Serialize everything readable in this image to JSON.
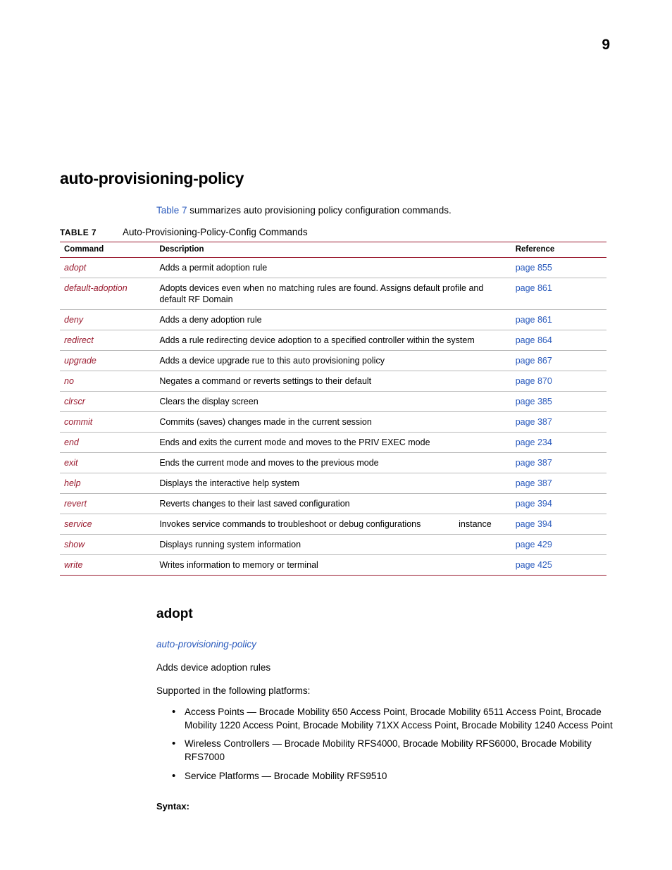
{
  "page": {
    "number": "9"
  },
  "section": {
    "title": "auto-provisioning-policy",
    "intro_link": "Table 7",
    "intro_text": " summarizes auto provisioning policy configuration commands."
  },
  "table": {
    "label": "TABLE 7",
    "caption": "Auto-Provisioning-Policy-Config Commands",
    "headers": [
      "Command",
      "Description",
      "Reference"
    ],
    "rows": [
      {
        "command": "adopt",
        "description": "Adds a permit adoption rule",
        "extra": "",
        "reference": "page 855"
      },
      {
        "command": "default-adoption",
        "description": "Adopts devices even when no matching rules are found. Assigns default profile and default RF Domain",
        "extra": "",
        "reference": "page 861"
      },
      {
        "command": "deny",
        "description": "Adds a deny adoption rule",
        "extra": "",
        "reference": "page 861"
      },
      {
        "command": "redirect",
        "description": "Adds a rule redirecting device adoption to a specified controller within the system",
        "extra": "",
        "reference": "page 864"
      },
      {
        "command": "upgrade",
        "description": "Adds a device upgrade rue to this auto provisioning policy",
        "extra": "",
        "reference": "page 867"
      },
      {
        "command": "no",
        "description": "Negates a command or reverts settings to their default",
        "extra": "",
        "reference": "page 870"
      },
      {
        "command": "clrscr",
        "description": "Clears the display screen",
        "extra": "",
        "reference": "page 385"
      },
      {
        "command": "commit",
        "description": "Commits (saves) changes made in the current session",
        "extra": "",
        "reference": "page 387"
      },
      {
        "command": "end",
        "description": "Ends and exits the current mode and moves to the PRIV EXEC mode",
        "extra": "",
        "reference": "page 234"
      },
      {
        "command": "exit",
        "description": "Ends the current mode and moves to the previous mode",
        "extra": "",
        "reference": "page 387"
      },
      {
        "command": "help",
        "description": "Displays the interactive help system",
        "extra": "",
        "reference": "page 387"
      },
      {
        "command": "revert",
        "description": "Reverts changes to their last saved configuration",
        "extra": "",
        "reference": "page 394"
      },
      {
        "command": "service",
        "description": "Invokes service commands to troubleshoot or debug configurations",
        "extra": "instance",
        "reference": "page 394"
      },
      {
        "command": "show",
        "description": "Displays running system information",
        "extra": "",
        "reference": "page 429"
      },
      {
        "command": "write",
        "description": "Writes information to memory or terminal",
        "extra": "",
        "reference": "page 425"
      }
    ]
  },
  "subsection": {
    "title": "adopt",
    "parent_link": "auto-provisioning-policy",
    "description": "Adds device adoption rules",
    "supported_intro": "Supported in the following platforms:",
    "platforms": [
      "Access Points — Brocade Mobility 650 Access Point, Brocade Mobility 6511 Access Point, Brocade Mobility 1220 Access Point, Brocade Mobility 71XX Access Point, Brocade Mobility 1240 Access Point",
      "Wireless Controllers — Brocade Mobility RFS4000, Brocade Mobility RFS6000, Brocade Mobility RFS7000",
      "Service Platforms — Brocade Mobility RFS9510"
    ],
    "syntax_label": "Syntax:"
  },
  "colors": {
    "link": "#2b5bbd",
    "command": "#9a1b2f",
    "rule": "#9a1b2f"
  }
}
